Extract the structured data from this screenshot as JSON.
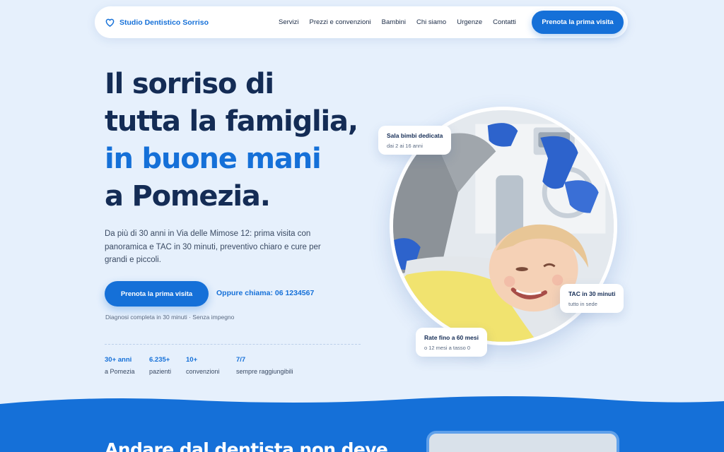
{
  "nav": {
    "brand": "Studio Dentistico Sorriso",
    "items": [
      "Servizi",
      "Prezzi e convenzioni",
      "Bambini",
      "Chi siamo",
      "Urgenze",
      "Contatti"
    ],
    "cta": "Prenota la prima visita"
  },
  "hero": {
    "headline": [
      "Il sorriso di",
      "tutta la famiglia,",
      "in buone mani",
      "a Pomezia."
    ],
    "lead": "Da più di 30 anni in Via delle Mimose 12: prima visita con panoramica e TAC in 30 minuti, preventivo chiaro e cure per grandi e piccoli.",
    "cta": "Prenota la prima visita",
    "call": "Oppure chiama: 06 1234567",
    "note": "Diagnosi completa in 30 minuti · Senza impegno",
    "stats": [
      {
        "value": "30+ anni",
        "label": "a Pomezia"
      },
      {
        "value": "6.235+",
        "label": "pazienti"
      },
      {
        "value": "10+",
        "label": "convenzioni"
      },
      {
        "value": "7/7",
        "label": "sempre raggiungibili"
      }
    ]
  },
  "badges": {
    "kids": {
      "title": "Sala bimbi dedicata",
      "subtitle": "dai 2 ai 16 anni"
    },
    "tac": {
      "title": "TAC in 30 minuti",
      "subtitle": "tutto in sede"
    },
    "rate": {
      "title": "Rate fino a 60 mesi",
      "subtitle": "o 12 mesi a tasso 0"
    }
  },
  "section2": {
    "title": "Andare dal dentista non deve"
  },
  "colors": {
    "primary": "#1570d8",
    "navy": "#142c55",
    "background": "#e6f0fc"
  },
  "icons": {
    "brand": "tooth-heart-icon"
  }
}
